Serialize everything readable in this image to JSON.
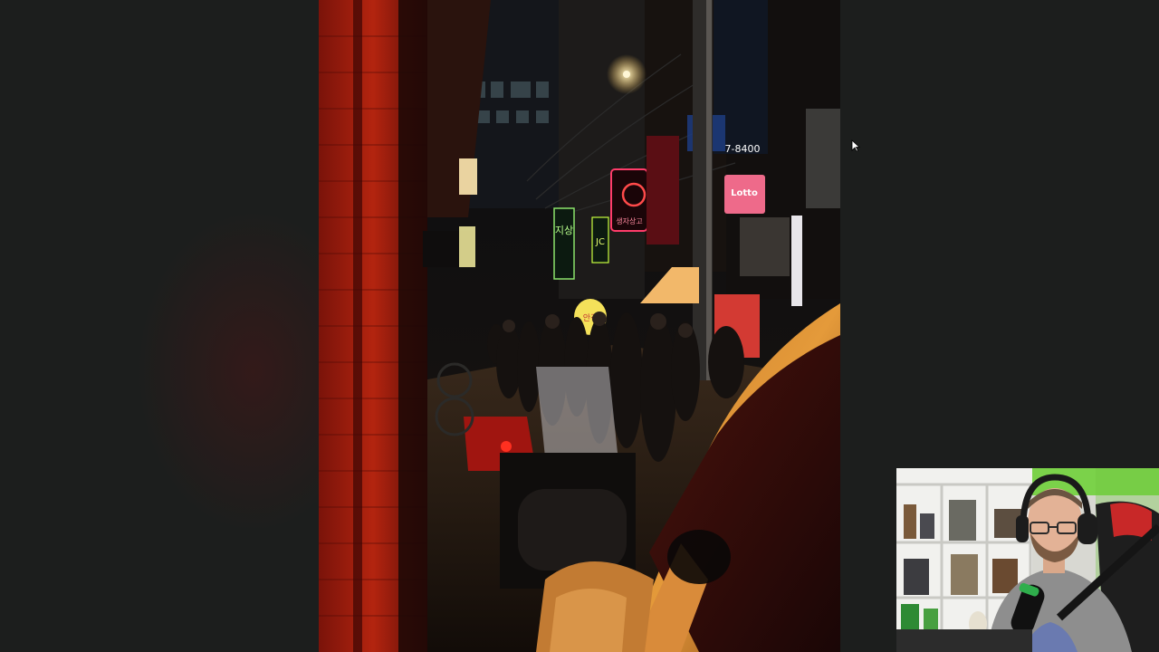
{
  "viewer": {
    "background_color": "#1c1e1d",
    "photo_description_icon": "photo-street-night"
  },
  "photo": {
    "signs": {
      "lotto": "Lotto",
      "korean_vertical_green": "지상",
      "round_yellow": "안경",
      "phone_number": "7-8400",
      "neon_red_caption": "생자상고"
    }
  },
  "webcam": {
    "icon": "webcam-person"
  },
  "cursor": {
    "icon": "mouse-pointer-icon"
  }
}
